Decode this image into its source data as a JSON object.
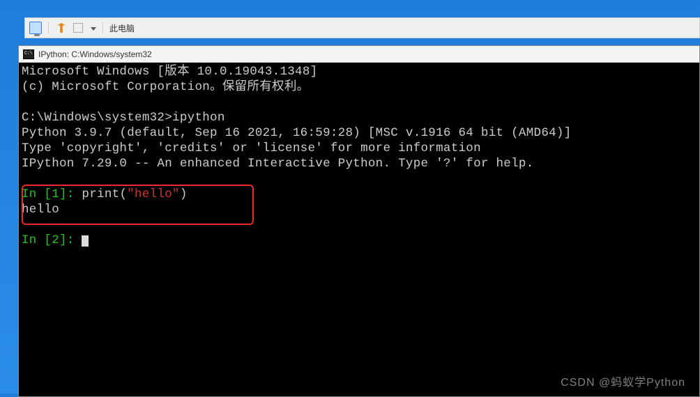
{
  "explorer": {
    "label": "此电脑"
  },
  "titlebar": {
    "title": "IPython: C:Windows/system32"
  },
  "terminal": {
    "line1": "Microsoft Windows [版本 10.0.19043.1348]",
    "line2": "(c) Microsoft Corporation。保留所有权利。",
    "promptLine": "C:\\Windows\\system32>ipython",
    "pyVersion": "Python 3.9.7 (default, Sep 16 2021, 16:59:28) [MSC v.1916 64 bit (AMD64)]",
    "pyHint": "Type 'copyright', 'credits' or 'license' for more information",
    "ipyBanner": "IPython 7.29.0 -- An enhanced Interactive Python. Type '?' for help.",
    "in1_prompt": "In [1]: ",
    "in1_cmd1": "print",
    "in1_paren_open": "(",
    "in1_str": "\"hello\"",
    "in1_paren_close": ")",
    "out1": "hello",
    "in2_prompt": "In [2]: "
  },
  "watermark": "CSDN @蚂蚁学Python"
}
